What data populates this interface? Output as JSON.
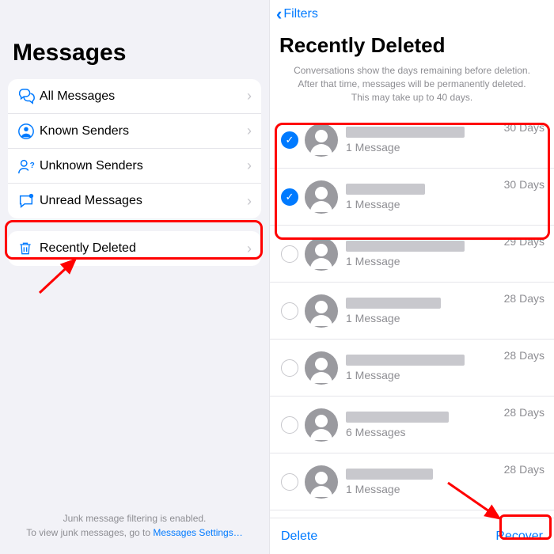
{
  "left": {
    "title": "Messages",
    "rows": [
      {
        "label": "All Messages"
      },
      {
        "label": "Known Senders"
      },
      {
        "label": "Unknown Senders"
      },
      {
        "label": "Unread Messages"
      }
    ],
    "recently_deleted_label": "Recently Deleted",
    "footer_line1": "Junk message filtering is enabled.",
    "footer_line2": "To view junk messages, go to ",
    "footer_link": "Messages Settings…"
  },
  "right": {
    "back_label": "Filters",
    "title": "Recently Deleted",
    "info1": "Conversations show the days remaining before deletion.",
    "info2": "After that time, messages will be permanently deleted.",
    "info3": "This may take up to 40 days.",
    "items": [
      {
        "selected": true,
        "name_w": 150,
        "count": "1 Message",
        "days": "30 Days"
      },
      {
        "selected": true,
        "name_w": 100,
        "count": "1 Message",
        "days": "30 Days"
      },
      {
        "selected": false,
        "name_w": 150,
        "count": "1 Message",
        "days": "29 Days"
      },
      {
        "selected": false,
        "name_w": 120,
        "count": "1 Message",
        "days": "28 Days"
      },
      {
        "selected": false,
        "name_w": 150,
        "count": "1 Message",
        "days": "28 Days"
      },
      {
        "selected": false,
        "name_w": 130,
        "count": "6 Messages",
        "days": "28 Days"
      },
      {
        "selected": false,
        "name_w": 110,
        "count": "1 Message",
        "days": "28 Days"
      }
    ],
    "toolbar": {
      "delete": "Delete",
      "recover": "Recover"
    }
  }
}
